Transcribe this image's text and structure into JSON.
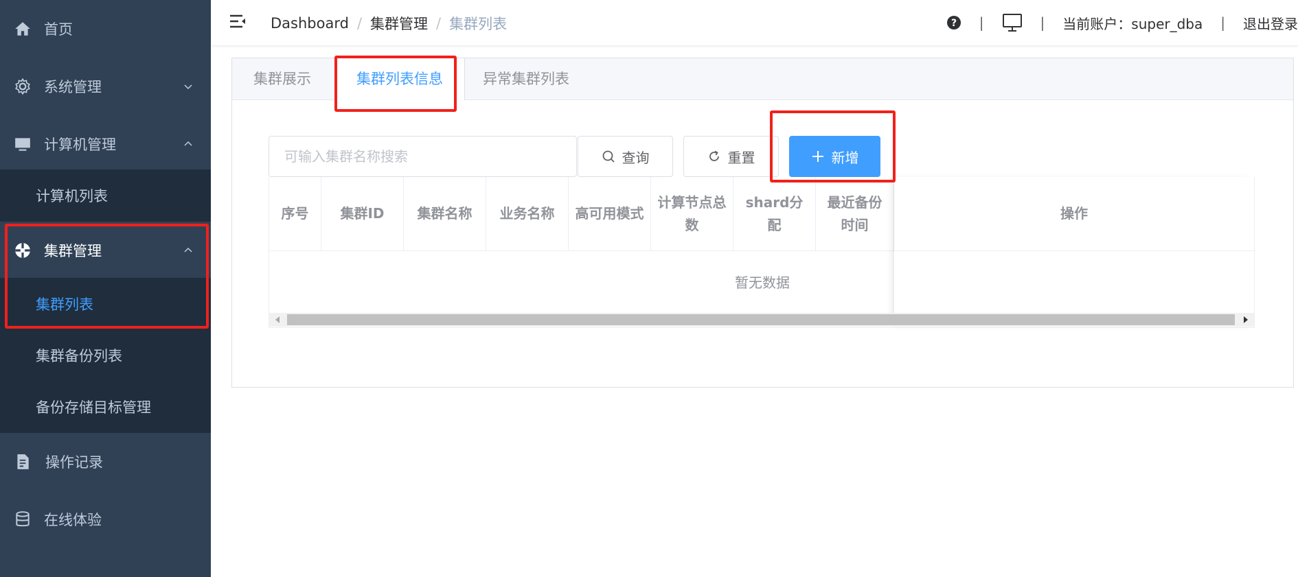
{
  "sidebar": {
    "items": [
      {
        "label": "首页",
        "icon": "home-icon"
      },
      {
        "label": "系统管理",
        "icon": "gear-icon"
      },
      {
        "label": "计算机管理",
        "icon": "monitor-icon"
      },
      {
        "label": "集群管理",
        "icon": "cluster-icon"
      },
      {
        "label": "操作记录",
        "icon": "document-icon"
      },
      {
        "label": "在线体验",
        "icon": "database-icon"
      }
    ],
    "computer_sub": [
      {
        "label": "计算机列表"
      }
    ],
    "cluster_sub": [
      {
        "label": "集群列表"
      },
      {
        "label": "集群备份列表"
      },
      {
        "label": "备份存储目标管理"
      }
    ]
  },
  "header": {
    "breadcrumb": [
      "Dashboard",
      "集群管理",
      "集群列表"
    ],
    "breadcrumb_sep": "/",
    "separator": "|",
    "account_label": "当前账户：super_dba",
    "logout_label": "退出登录"
  },
  "tabs": [
    {
      "label": "集群展示"
    },
    {
      "label": "集群列表信息"
    },
    {
      "label": "异常集群列表"
    }
  ],
  "search": {
    "placeholder": "可输入集群名称搜索",
    "query_label": "查询",
    "reset_label": "重置",
    "add_label": "新增"
  },
  "table": {
    "columns": [
      "序号",
      "集群ID",
      "集群名称",
      "业务名称",
      "高可用模式",
      "计算节点总数",
      "shard分配",
      "最近备份时间",
      "操作"
    ],
    "empty_text": "暂无数据"
  },
  "colors": {
    "sidebar_bg": "#304156",
    "submenu_bg": "#1f2d3d",
    "accent": "#409eff",
    "highlight": "#f0211b"
  }
}
